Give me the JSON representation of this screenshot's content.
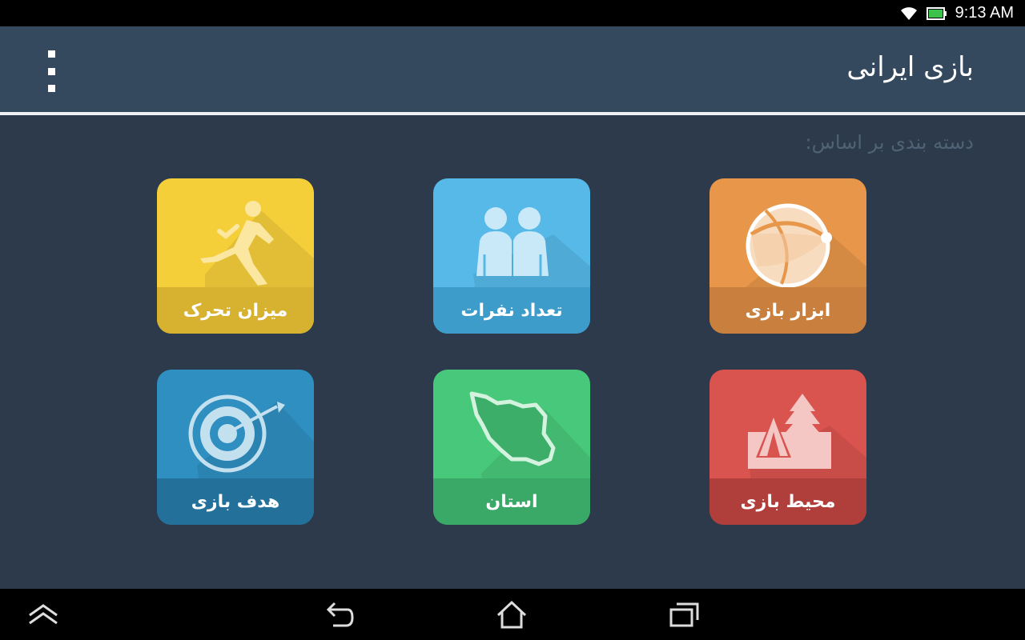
{
  "status": {
    "time": "9:13 AM"
  },
  "appbar": {
    "title": "بازی ایرانی",
    "menu_icon": "overflow-menu-icon"
  },
  "subtitle": "دسته بندی بر اساس:",
  "tiles": [
    {
      "label": "ابزار بازی",
      "icon": "ball-icon",
      "color": "#e8964a",
      "band": "#c97f3d"
    },
    {
      "label": "تعداد نفرات",
      "icon": "people-icon",
      "color": "#56b9e8",
      "band": "#3e9ccb"
    },
    {
      "label": "میزان تحرک",
      "icon": "running-icon",
      "color": "#f5cf3a",
      "band": "#d7b230"
    },
    {
      "label": "محیط بازی",
      "icon": "tent-tree-icon",
      "color": "#d9534f",
      "band": "#b03e3b"
    },
    {
      "label": "استان",
      "icon": "iran-map-icon",
      "color": "#48c87a",
      "band": "#3aa866"
    },
    {
      "label": "هدف بازی",
      "icon": "target-icon",
      "color": "#2e8fc0",
      "band": "#23719b"
    }
  ],
  "navbar": {
    "icons": [
      "up-icon",
      "back-icon",
      "home-icon",
      "recents-icon"
    ]
  }
}
